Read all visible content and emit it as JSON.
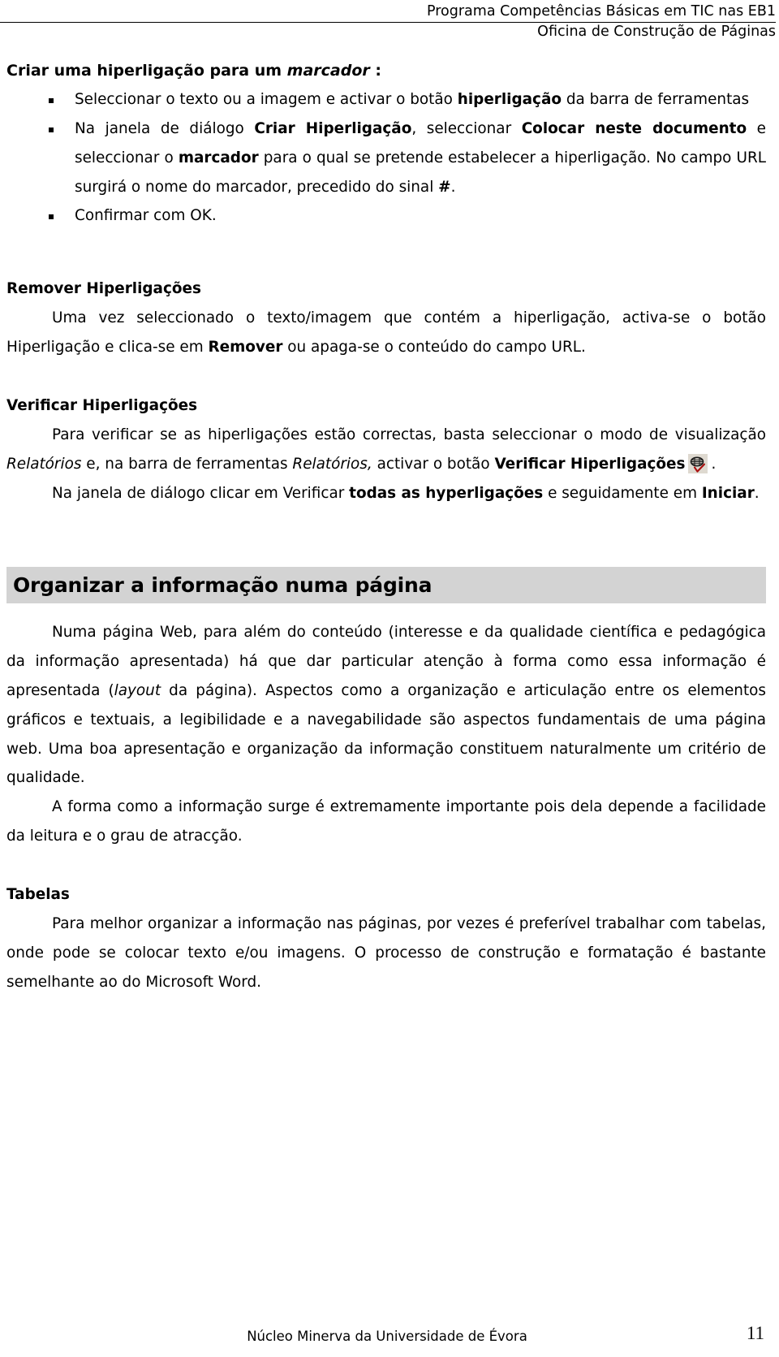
{
  "header": {
    "line1": "Programa Competências Básicas em TIC nas EB1",
    "line2": "Oficina de Construção de Páginas"
  },
  "section_bookmark": {
    "title_part1": "Criar uma hiperligação para um ",
    "title_italic": "marcador",
    "title_part3": " :",
    "bullets": [
      {
        "seg1": "Seleccionar o texto ou a imagem e activar o botão ",
        "bold1": "hiperligação",
        "seg2": " da barra de ferramentas"
      },
      {
        "seg1": "Na janela de diálogo ",
        "bold1": "Criar Hiperligação",
        "seg2": ", seleccionar ",
        "bold2": "Colocar neste documento",
        "seg3": " e seleccionar o ",
        "bold3": "marcador",
        "seg4": " para o qual se pretende estabelecer a hiperligação. No campo URL surgirá o nome do marcador, precedido do sinal ",
        "bold4": "#",
        "seg5": "."
      },
      {
        "seg1": "Confirmar com OK."
      }
    ]
  },
  "section_remove": {
    "heading": "Remover Hiperligações",
    "para_seg1": "Uma vez seleccionado o texto/imagem que contém a hiperligação, activa-se o botão Hiperligação e clica-se em ",
    "para_bold1": "Remover",
    "para_seg2": " ou apaga-se o conteúdo do campo URL."
  },
  "section_verify": {
    "heading": "Verificar Hiperligações",
    "para1_seg1": "Para verificar se as hiperligações estão correctas, basta seleccionar o modo de visualização ",
    "para1_italic1": "Relatórios",
    "para1_seg2": " e, na barra de ferramentas ",
    "para1_italic2": "Relatórios,",
    "para1_seg3": " activar o botão ",
    "para1_bold1": "Verificar   Hiperligações",
    "icon_name": "verify-hyperlinks-toolbar-icon",
    "para1_seg4": ".",
    "para2_seg1": "Na janela de diálogo clicar em Verificar ",
    "para2_bold1": "todas as hyperligações",
    "para2_seg2": " e seguidamente em ",
    "para2_bold2": "Iniciar",
    "para2_seg3": "."
  },
  "section_organize": {
    "heading": "Organizar a informação numa página",
    "para1_seg1": "Numa página Web, para além do conteúdo (interesse e da qualidade científica e pedagógica da informação apresentada) há que dar particular atenção à forma como essa informação é apresentada (",
    "para1_italic1": "layout",
    "para1_seg2": " da página). Aspectos como a organização e articulação entre os elementos gráficos e textuais, a legibilidade e a navegabilidade são aspectos fundamentais de uma página web. Uma boa apresentação e organização da informação constituem naturalmente um critério de qualidade.",
    "para2": "A forma como a informação surge é extremamente importante pois dela depende a facilidade da leitura e o grau de atracção."
  },
  "section_tables": {
    "heading": "Tabelas",
    "para1": "Para melhor organizar a informação nas páginas, por vezes é preferível trabalhar com tabelas, onde pode se colocar texto e/ou imagens. O processo de construção e formatação é bastante semelhante ao do Microsoft Word."
  },
  "footer": {
    "organization": "Núcleo Minerva da Universidade de Évora",
    "page_number": "11"
  },
  "colors": {
    "banner_background": "#d3d3d3",
    "text": "#000000",
    "icon_button_background": "#ded9d0",
    "icon_check": "#aa1111"
  }
}
